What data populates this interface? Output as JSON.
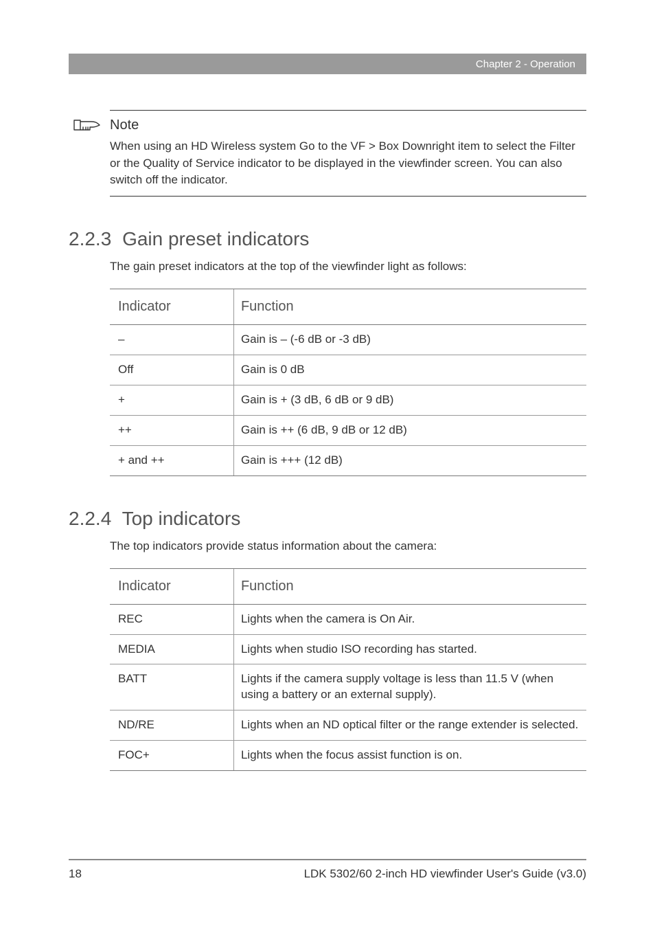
{
  "header": {
    "chapter": "Chapter 2 - Operation"
  },
  "note": {
    "title": "Note",
    "body": "When using an HD Wireless system Go to the VF > Box Downright item to select the Filter or the Quality of Service indicator to be displayed in the viewfinder screen. You can also switch off the indicator."
  },
  "section_gain": {
    "number": "2.2.3",
    "title": "Gain preset indicators",
    "intro": "The gain preset indicators at the top of the viewfinder light as follows:",
    "columns": [
      "Indicator",
      "Function"
    ],
    "rows": [
      {
        "indicator": "–",
        "function": "Gain is – (-6 dB or -3 dB)"
      },
      {
        "indicator": "Off",
        "function": "Gain is 0 dB"
      },
      {
        "indicator": "+",
        "function": "Gain is + (3 dB, 6 dB or 9 dB)"
      },
      {
        "indicator": "++",
        "function": "Gain is ++ (6 dB, 9 dB or 12 dB)"
      },
      {
        "indicator": "+ and ++",
        "function": "Gain is +++ (12 dB)"
      }
    ]
  },
  "section_top": {
    "number": "2.2.4",
    "title": "Top indicators",
    "intro": "The top indicators provide status information about the camera:",
    "columns": [
      "Indicator",
      "Function"
    ],
    "rows": [
      {
        "indicator": "REC",
        "function": "Lights when the camera is On Air."
      },
      {
        "indicator": "MEDIA",
        "function": "Lights when studio ISO recording has started."
      },
      {
        "indicator": "BATT",
        "function": "Lights if the camera supply voltage is less than 11.5 V (when using a battery or an external supply)."
      },
      {
        "indicator": "ND/RE",
        "function": "Lights when an ND optical filter or the range extender is selected."
      },
      {
        "indicator": "FOC+",
        "function": "Lights when the focus assist function is on."
      }
    ]
  },
  "footer": {
    "page": "18",
    "doc": "LDK 5302/60 2-inch HD viewfinder User's Guide (v3.0)"
  }
}
